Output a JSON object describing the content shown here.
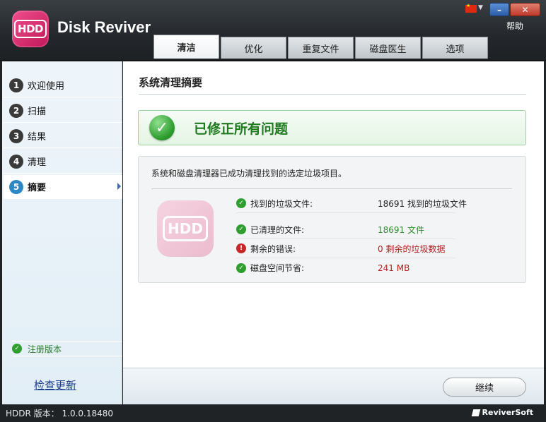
{
  "window": {
    "app_title": "Disk Reviver",
    "logo_text": "HDD",
    "minimize_label": "–",
    "close_label": "✕",
    "help_label": "帮助",
    "language_flag_icon": "china-flag-icon"
  },
  "tabs": [
    {
      "label": "清洁",
      "active": true
    },
    {
      "label": "优化",
      "active": false
    },
    {
      "label": "重复文件",
      "active": false
    },
    {
      "label": "磁盘医生",
      "active": false
    },
    {
      "label": "选项",
      "active": false
    }
  ],
  "sidebar": {
    "items": [
      {
        "num": "1",
        "label": "欢迎使用"
      },
      {
        "num": "2",
        "label": "扫描"
      },
      {
        "num": "3",
        "label": "结果"
      },
      {
        "num": "4",
        "label": "清理"
      },
      {
        "num": "5",
        "label": "摘要"
      }
    ],
    "registered_label": "注册版本",
    "check_update_label": "检查更新"
  },
  "main": {
    "section_title": "系统清理摘要",
    "success_message": "已修正所有问题",
    "summary_description": "系统和磁盘清理器已成功清理找到的选定垃圾项目。",
    "stats": [
      {
        "label": "找到的垃圾文件:",
        "value": "18691 找到的垃圾文件",
        "status": "ok",
        "color": "#222222"
      },
      {
        "label": "已清理的文件:",
        "value": "18691 文件",
        "status": "ok",
        "color": "#2e8b2e"
      },
      {
        "label": "剩余的错误:",
        "value": "0 剩余的垃圾数据",
        "status": "error",
        "color": "#b32020"
      },
      {
        "label": "磁盘空间节省:",
        "value": "241 MB",
        "status": "ok",
        "color": "#b32020"
      }
    ],
    "continue_label": "继续"
  },
  "statusbar": {
    "version_label": "HDDR 版本：",
    "version_value": "1.0.0.18480",
    "brand": "ReviverSoft"
  },
  "colors": {
    "accent_blue": "#2c88c4",
    "success_green": "#2e9e2e",
    "error_red": "#c62828"
  }
}
